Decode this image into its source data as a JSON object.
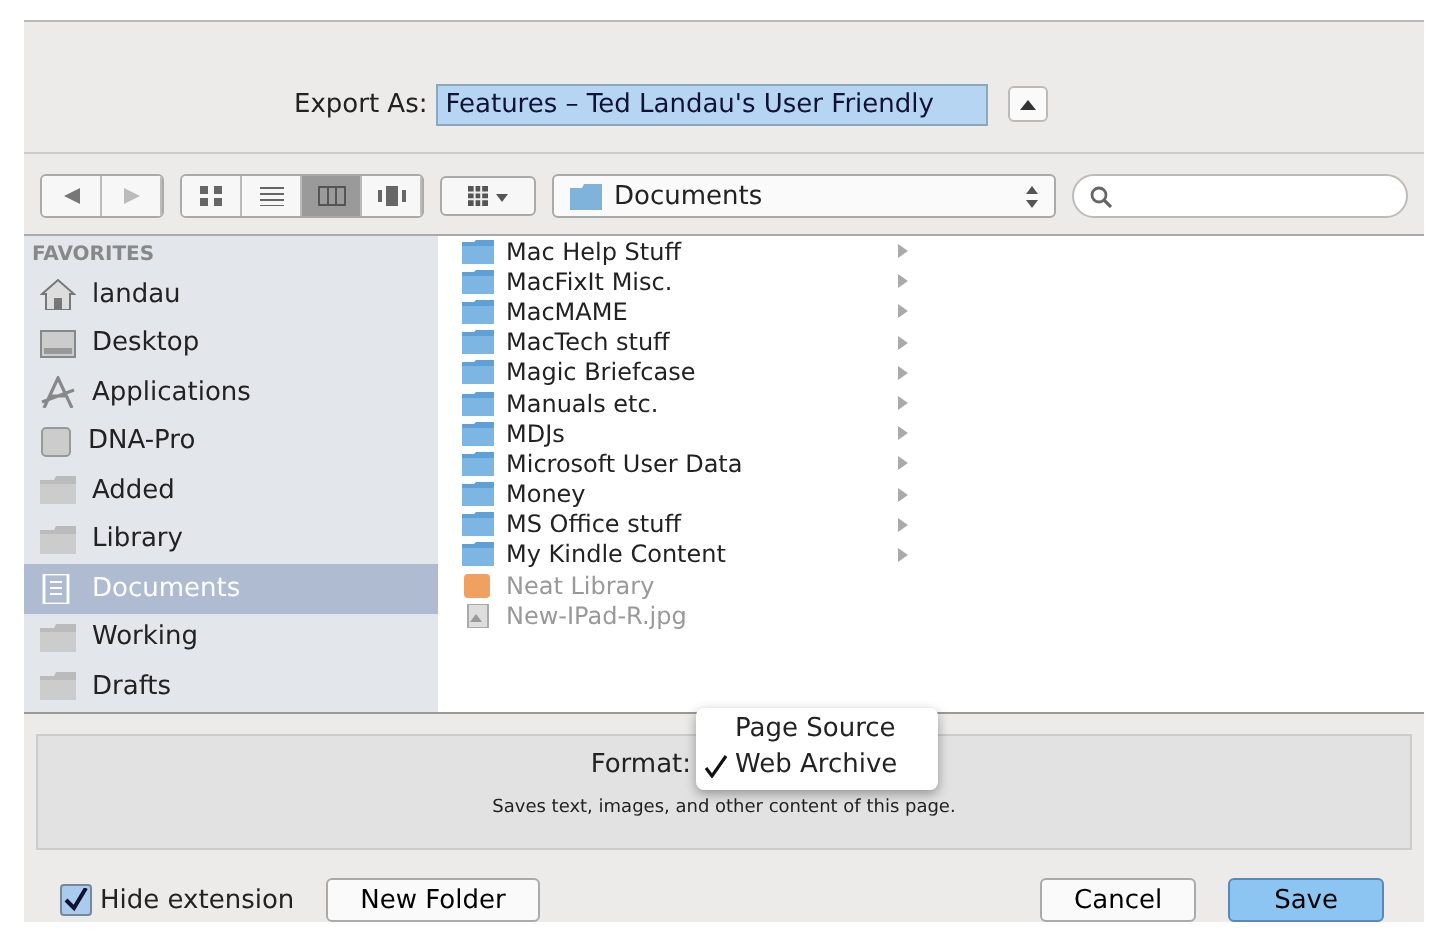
{
  "export_as": {
    "label": "Export As:",
    "value": "Features – Ted Landau's User Friendly"
  },
  "toolbar": {
    "path": "Documents",
    "views": [
      {
        "kind": "icons",
        "selected": false
      },
      {
        "kind": "list",
        "selected": false
      },
      {
        "kind": "columns",
        "selected": true
      },
      {
        "kind": "flow",
        "selected": false
      }
    ]
  },
  "sidebar": {
    "heading": "FAVORITES",
    "items": [
      {
        "label": "landau",
        "kind": "home",
        "selected": false
      },
      {
        "label": "Desktop",
        "kind": "desktop",
        "selected": false
      },
      {
        "label": "Applications",
        "kind": "apps",
        "selected": false
      },
      {
        "label": "DNA-Pro",
        "kind": "disk",
        "selected": false
      },
      {
        "label": "Added",
        "kind": "folder",
        "selected": false
      },
      {
        "label": "Library",
        "kind": "folder",
        "selected": false
      },
      {
        "label": "Documents",
        "kind": "docs",
        "selected": true
      },
      {
        "label": "Working",
        "kind": "folder",
        "selected": false
      },
      {
        "label": "Drafts",
        "kind": "folder",
        "selected": false
      }
    ]
  },
  "files": [
    {
      "name": "Mac Help Stuff",
      "kind": "folder",
      "disabled": false
    },
    {
      "name": "MacFixIt Misc.",
      "kind": "folder",
      "disabled": false
    },
    {
      "name": "MacMAME",
      "kind": "folder",
      "disabled": false
    },
    {
      "name": "MacTech stuff",
      "kind": "folder",
      "disabled": false
    },
    {
      "name": "Magic Briefcase",
      "kind": "folder",
      "disabled": false
    },
    {
      "name": "Manuals etc.",
      "kind": "folder",
      "disabled": false
    },
    {
      "name": "MDJs",
      "kind": "folder",
      "disabled": false
    },
    {
      "name": "Microsoft User Data",
      "kind": "folder",
      "disabled": false
    },
    {
      "name": "Money",
      "kind": "folder",
      "disabled": false
    },
    {
      "name": "MS Office stuff",
      "kind": "folder",
      "disabled": false
    },
    {
      "name": "My Kindle Content",
      "kind": "folder",
      "disabled": false
    },
    {
      "name": "Neat Library",
      "kind": "library",
      "disabled": true
    },
    {
      "name": "New-IPad-R.jpg",
      "kind": "image",
      "disabled": true
    }
  ],
  "format": {
    "label": "Format:",
    "options": [
      {
        "label": "Page Source",
        "selected": false
      },
      {
        "label": "Web Archive",
        "selected": true
      }
    ],
    "description": "Saves text, images, and other content of this page."
  },
  "hide_extension": {
    "label": "Hide extension",
    "checked": true
  },
  "buttons": [
    {
      "label": "New Folder",
      "kind": "plain"
    },
    {
      "label": "Cancel",
      "kind": "plain"
    },
    {
      "label": "Save",
      "kind": "default"
    }
  ]
}
